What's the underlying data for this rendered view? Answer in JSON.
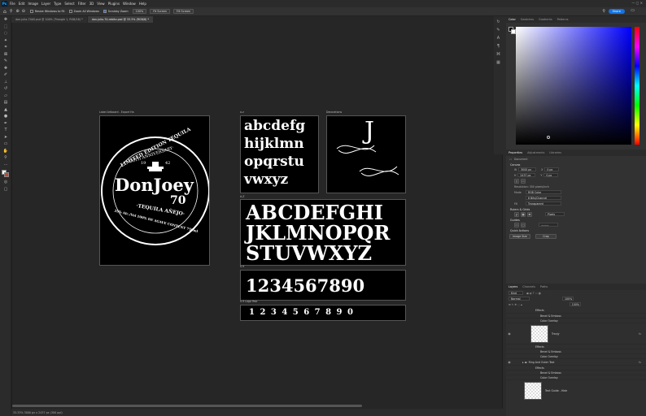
{
  "app": {
    "logo": "Ps",
    "menu": [
      "File",
      "Edit",
      "Image",
      "Layer",
      "Type",
      "Select",
      "Filter",
      "3D",
      "View",
      "Plugins",
      "Window",
      "Help"
    ]
  },
  "options": {
    "resize_windows": "Resize Windows to Fit",
    "zoom_all": "Zoom All Windows",
    "scrubby": "Scrubby Zoom",
    "zoom_pct": "100%",
    "fit_screen": "Fit Screen",
    "fill_screen": "Fill Screen",
    "share": "Share"
  },
  "tabs": [
    "don-julio-70AS.psd @ 100% (Triangle 1, RGB/16) *",
    "don-julio-70-rebikz.psd @ 33.3% (RGB/8) *"
  ],
  "status": "33.33%    3000 px x 2437 px (300 ppi)",
  "artboards": {
    "label": {
      "title": "Label Artboard - Export Ha",
      "limited": "LIMITED EDITION TEQUILA",
      "anniv": "·70TH ANNIVERSARY·",
      "year_l": "19",
      "year_r": "42",
      "brand": "DonJoey",
      "num": "70",
      "tequila": "·TEQUILA AÑEJO·",
      "bottom": "35% Alc./Vol 100% DE AGAVE CONTENT 750ml"
    },
    "lower": {
      "title": "a-z",
      "line1": "abcdefg",
      "line2": "hijklmn",
      "line3": "opqrstu",
      "line4": "vwxyz"
    },
    "deco": {
      "title": "Decorations",
      "glyph": "J"
    },
    "upper": {
      "title": "A-Z",
      "line1": "ABCDEFGHI",
      "line2": "JKLMNOPQR",
      "line3": "STUVWXYZ"
    },
    "nums": {
      "title": "0-9",
      "line": "1234567890"
    },
    "logo": {
      "title": "0-9 Logo Year",
      "line": "1 2 3 4 5 6 7 8 9 0"
    }
  },
  "panel_top": {
    "tabs": [
      "Color",
      "Swatches",
      "Gradients",
      "Patterns"
    ]
  },
  "properties": {
    "tabs": [
      "Properties",
      "Adjustments",
      "Libraries"
    ],
    "doc": "Document",
    "canvas": "Canvas",
    "w": "3000 px",
    "h": "2437 px",
    "x": "0 px",
    "y": "0 px",
    "res": "Resolution: 300 pixels/inch",
    "mode_l": "Mode",
    "mode": "RGB Color",
    "bits": "8 Bits/Channel",
    "fill_l": "Fill",
    "fill": "Transparent",
    "rulers": "Rulers & Grids",
    "pixels": "Pixels",
    "guides": "Guides",
    "quick": "Quick Actions",
    "image_size": "Image Size",
    "crop": "Crop"
  },
  "layers": {
    "tabs": [
      "Layers",
      "Channels",
      "Paths"
    ],
    "kind": "Kind",
    "opacity": "100%",
    "fill": "100%",
    "rows": [
      "Effects",
      "Bevel & Emboss",
      "Color Overlay",
      "Tranjy",
      "Effects",
      "Bevel & Emboss",
      "Color Overlay",
      "Ring And Outer Text",
      "Effects",
      "Bevel & Emboss",
      "Color Overlay",
      "Text Guide - Hide"
    ]
  },
  "colors": {
    "accent": "#1473e6",
    "picker_hue": "#0000ff"
  }
}
